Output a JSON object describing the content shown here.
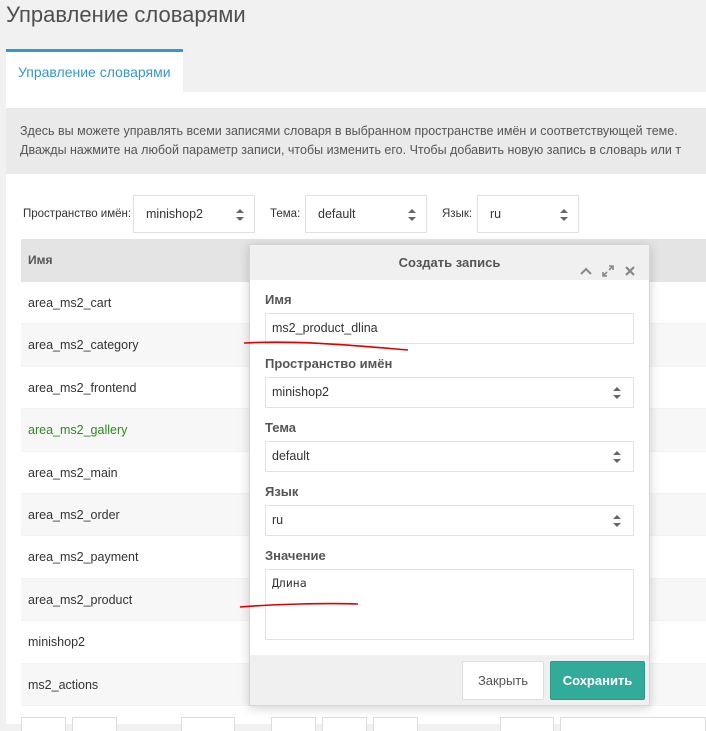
{
  "page": {
    "title": "Управление словарями"
  },
  "tabs": [
    {
      "label": "Управление словарями"
    }
  ],
  "description": {
    "line1": "Здесь вы можете управлять всеми записями словаря в выбранном пространстве имён и соответствующей теме.",
    "line2": "Дважды нажмите на любой параметр записи, чтобы изменить его. Чтобы добавить новую запись в словарь или т"
  },
  "filters": {
    "namespace": {
      "label": "Пространство имён:",
      "value": "minishop2"
    },
    "topic": {
      "label": "Тема:",
      "value": "default"
    },
    "language": {
      "label": "Язык:",
      "value": "ru"
    }
  },
  "grid": {
    "column_name": "Имя",
    "rows": [
      "area_ms2_cart",
      "area_ms2_category",
      "area_ms2_frontend",
      "area_ms2_gallery",
      "area_ms2_main",
      "area_ms2_order",
      "area_ms2_payment",
      "area_ms2_product",
      "minishop2",
      "ms2_actions"
    ]
  },
  "modal": {
    "title": "Создать запись",
    "name_label": "Имя",
    "name_value": "ms2_product_dlina",
    "namespace_label": "Пространство имён",
    "namespace_value": "minishop2",
    "topic_label": "Тема",
    "topic_value": "default",
    "language_label": "Язык",
    "language_value": "ru",
    "value_label": "Значение",
    "value_text": "Длина",
    "close_label": "Закрыть",
    "save_label": "Сохранить"
  },
  "colors": {
    "accent": "#3697cd",
    "save_button": "#32ab9a",
    "highlight_text": "#2d8a1e",
    "annotation": "#e00000"
  },
  "icons": [
    "collapse-icon",
    "expand-icon",
    "close-icon",
    "spinner-icon"
  ]
}
